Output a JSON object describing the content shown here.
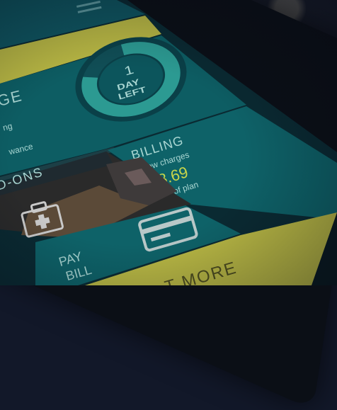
{
  "usage": {
    "title": "GE",
    "line1": "ng",
    "line2": "wance",
    "days_number": "1",
    "days_line1": "DAY",
    "days_line2": "LEFT",
    "days_left_fraction": 0.82
  },
  "billing": {
    "title": "BILLING",
    "subtitle": "New charges",
    "amount": "£8.69",
    "note": "out of plan"
  },
  "addons": {
    "title": "D-ONS"
  },
  "pay_bill": {
    "line1": "PAY",
    "line2": "BILL"
  },
  "footer": {
    "label": "T MORE"
  },
  "colors": {
    "teal_panel": "#0d5d63",
    "teal_dark": "#0a4a52",
    "yellow": "#c8c94a",
    "amount_yellow": "#c9d64a",
    "label_light": "#a9d6d2"
  },
  "icons": {
    "menu": "menu-icon",
    "first_aid": "first-aid-kit-icon",
    "card": "credit-card-icon",
    "donut": "donut-gauge"
  }
}
